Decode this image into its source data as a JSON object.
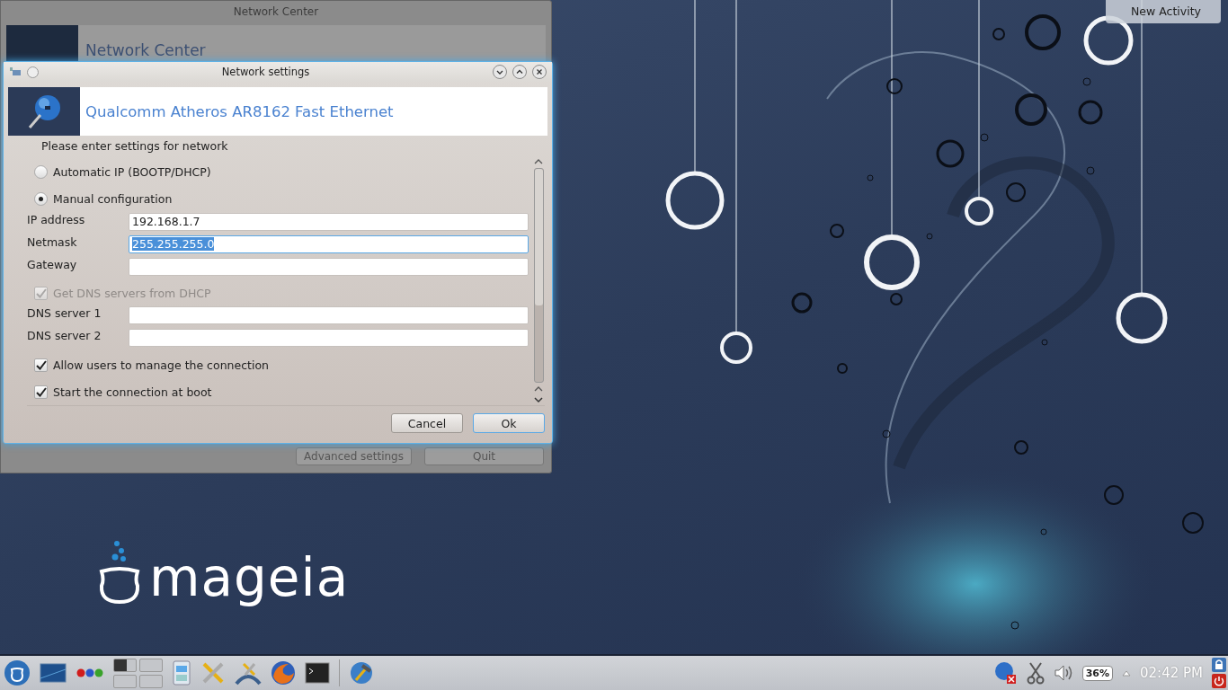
{
  "desktop": {
    "activity_button": "New Activity",
    "logo_text": "mageia"
  },
  "background_window": {
    "title": "Network Center",
    "header": "Network Center",
    "buttons": [
      "Advanced settings",
      "Quit"
    ]
  },
  "dialog": {
    "title": "Network settings",
    "header": "Qualcomm Atheros AR8162 Fast Ethernet",
    "prompt": "Please enter settings for network",
    "items": [
      {
        "kind": "radio",
        "label": "Automatic IP (BOOTP/DHCP)",
        "selected": false
      },
      {
        "kind": "radio",
        "label": "Manual configuration",
        "selected": true
      },
      {
        "kind": "field",
        "label": "IP address",
        "value": "192.168.1.7",
        "focused": false
      },
      {
        "kind": "field",
        "label": "Netmask",
        "value": "255.255.255.0",
        "focused": true
      },
      {
        "kind": "field",
        "label": "Gateway",
        "value": "",
        "focused": false
      },
      {
        "kind": "checkbox",
        "label": "Get DNS servers from DHCP",
        "checked": true,
        "disabled": true
      },
      {
        "kind": "field",
        "label": "DNS server 1",
        "value": "",
        "focused": false
      },
      {
        "kind": "field",
        "label": "DNS server 2",
        "value": "",
        "focused": false
      },
      {
        "kind": "checkbox",
        "label": "Allow users to manage the connection",
        "checked": true,
        "disabled": false
      },
      {
        "kind": "checkbox",
        "label": "Start the connection at boot",
        "checked": true,
        "disabled": false
      }
    ],
    "buttons": [
      {
        "label": "Cancel",
        "default": false
      },
      {
        "label": "Ok",
        "default": true
      }
    ]
  },
  "taskbar": {
    "battery": "36%",
    "clock": "02:42 PM"
  }
}
